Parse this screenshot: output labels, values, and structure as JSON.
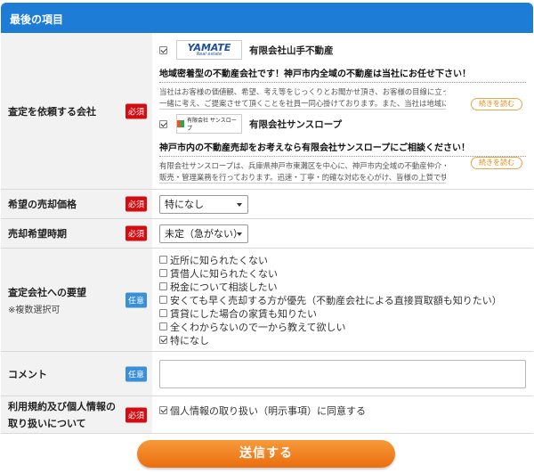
{
  "section": {
    "title": "最後の項目"
  },
  "badges": {
    "required": "必須",
    "optional": "任意"
  },
  "companies_field": {
    "label": "査定を依頼する会社",
    "companies": [
      {
        "logo_text": "YAMATE",
        "logo_sub": "Real estate",
        "name": "有限会社山手不動産",
        "tagline": "地域密着型の不動産会社です！神戸市内全域の不動産は当社にお任せ下さい！",
        "desc_line1": "当社はお客様の価値観、希望、考え等をじっくりとお聞かせ頂き、お客様の目線に立って",
        "desc_line2": "一緒に考え、ご提案させて頂くことを社員一同心掛けております。また、当社は地域に根",
        "more_label": "続きを読む",
        "checked": true
      },
      {
        "logo_text": "有限会社 サンスロープ",
        "name": "有限会社サンスロープ",
        "tagline": "神戸市内の不動産売却をお考えなら有限会社サンスロープにご相談ください！",
        "desc_line1": "有限会社サンスロープは、兵庫県神戸市東灘区を中心に、神戸市内全域の不動産仲介・買取",
        "desc_line2": "販売・管理業務を行っております。迅速・丁寧・的確な対応を心がけ、皆様の上質で快適",
        "more_label": "続きを読む",
        "checked": true
      }
    ]
  },
  "price_field": {
    "label": "希望の売却価格",
    "value": "特になし"
  },
  "timing_field": {
    "label": "売却希望時期",
    "value": "未定（急がない）"
  },
  "request_field": {
    "label": "査定会社への要望",
    "sub_label": "※複数選択可",
    "options": [
      {
        "label": "近所に知られたくない",
        "checked": false
      },
      {
        "label": "賃借人に知られたくない",
        "checked": false
      },
      {
        "label": "税金について相談したい",
        "checked": false
      },
      {
        "label": "安くても早く売却する方が優先（不動産会社による直接買取額も知りたい）",
        "checked": false
      },
      {
        "label": "賃貸にした場合の家賃も知りたい",
        "checked": false
      },
      {
        "label": "全くわからないので一から教えて欲しい",
        "checked": false
      },
      {
        "label": "特になし",
        "checked": true
      }
    ]
  },
  "comment_field": {
    "label": "コメント",
    "value": ""
  },
  "terms_field": {
    "label_line1": "利用規約及び個人情報の",
    "label_line2": "取り扱いについて",
    "checkbox_label": "個人情報の取り扱い（明示事項）に同意する",
    "checked": true
  },
  "submit": {
    "label": "送信する"
  },
  "colors": {
    "header": "#1c7cd6",
    "required": "#d40d12",
    "optional": "#3a8fd9",
    "submit": "#ea6e0e"
  }
}
